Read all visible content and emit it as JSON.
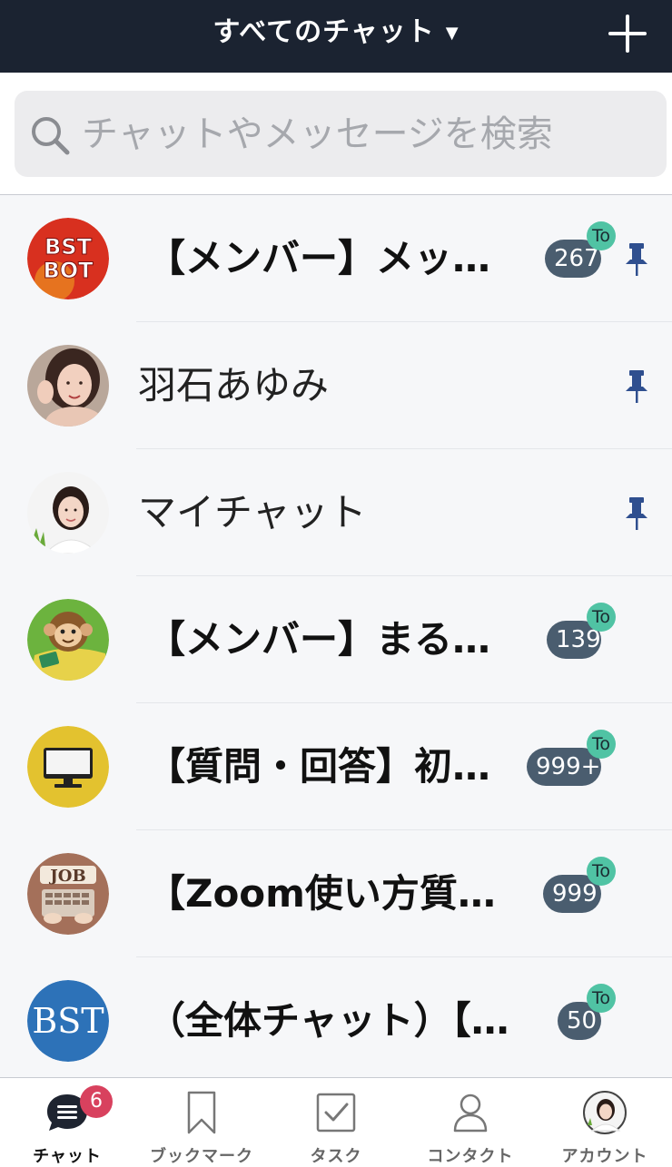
{
  "header": {
    "title": "すべてのチャット",
    "dropdown_icon": "caret-down-icon",
    "add_icon": "plus-icon"
  },
  "search": {
    "placeholder": "チャットやメッセージを検索",
    "icon": "search-icon"
  },
  "chats": [
    {
      "name": "【メンバー】メッ…",
      "bold": true,
      "count": "267",
      "to": "To",
      "pinned": true,
      "avatar": "bstbot"
    },
    {
      "name": "羽石あゆみ",
      "bold": false,
      "count": "",
      "to": "",
      "pinned": true,
      "avatar": "woman1"
    },
    {
      "name": "マイチャット",
      "bold": false,
      "count": "",
      "to": "",
      "pinned": true,
      "avatar": "woman2"
    },
    {
      "name": "【メンバー】まる…",
      "bold": true,
      "count": "139",
      "to": "To",
      "pinned": false,
      "avatar": "monkey"
    },
    {
      "name": "【質問・回答】初…",
      "bold": true,
      "count": "999+",
      "to": "To",
      "pinned": false,
      "avatar": "monitor"
    },
    {
      "name": "【Zoom使い方質…",
      "bold": true,
      "count": "999",
      "to": "To",
      "pinned": false,
      "avatar": "job"
    },
    {
      "name": "（全体チャット）【…",
      "bold": true,
      "count": "50",
      "to": "To",
      "pinned": false,
      "avatar": "bst"
    }
  ],
  "tabs": [
    {
      "label": "チャット",
      "icon": "chat-icon",
      "badge": "6",
      "active": true
    },
    {
      "label": "ブックマーク",
      "icon": "bookmark-icon",
      "badge": "",
      "active": false
    },
    {
      "label": "タスク",
      "icon": "task-checkbox-icon",
      "badge": "",
      "active": false
    },
    {
      "label": "コンタクト",
      "icon": "contact-person-icon",
      "badge": "",
      "active": false
    },
    {
      "label": "アカウント",
      "icon": "account-avatar-icon",
      "badge": "",
      "active": false
    }
  ],
  "colors": {
    "header_bg": "#1b2331",
    "count_badge": "#4a5d6f",
    "to_badge": "#50c3a4",
    "pin": "#2f4f8f",
    "tab_badge": "#d8415e"
  }
}
